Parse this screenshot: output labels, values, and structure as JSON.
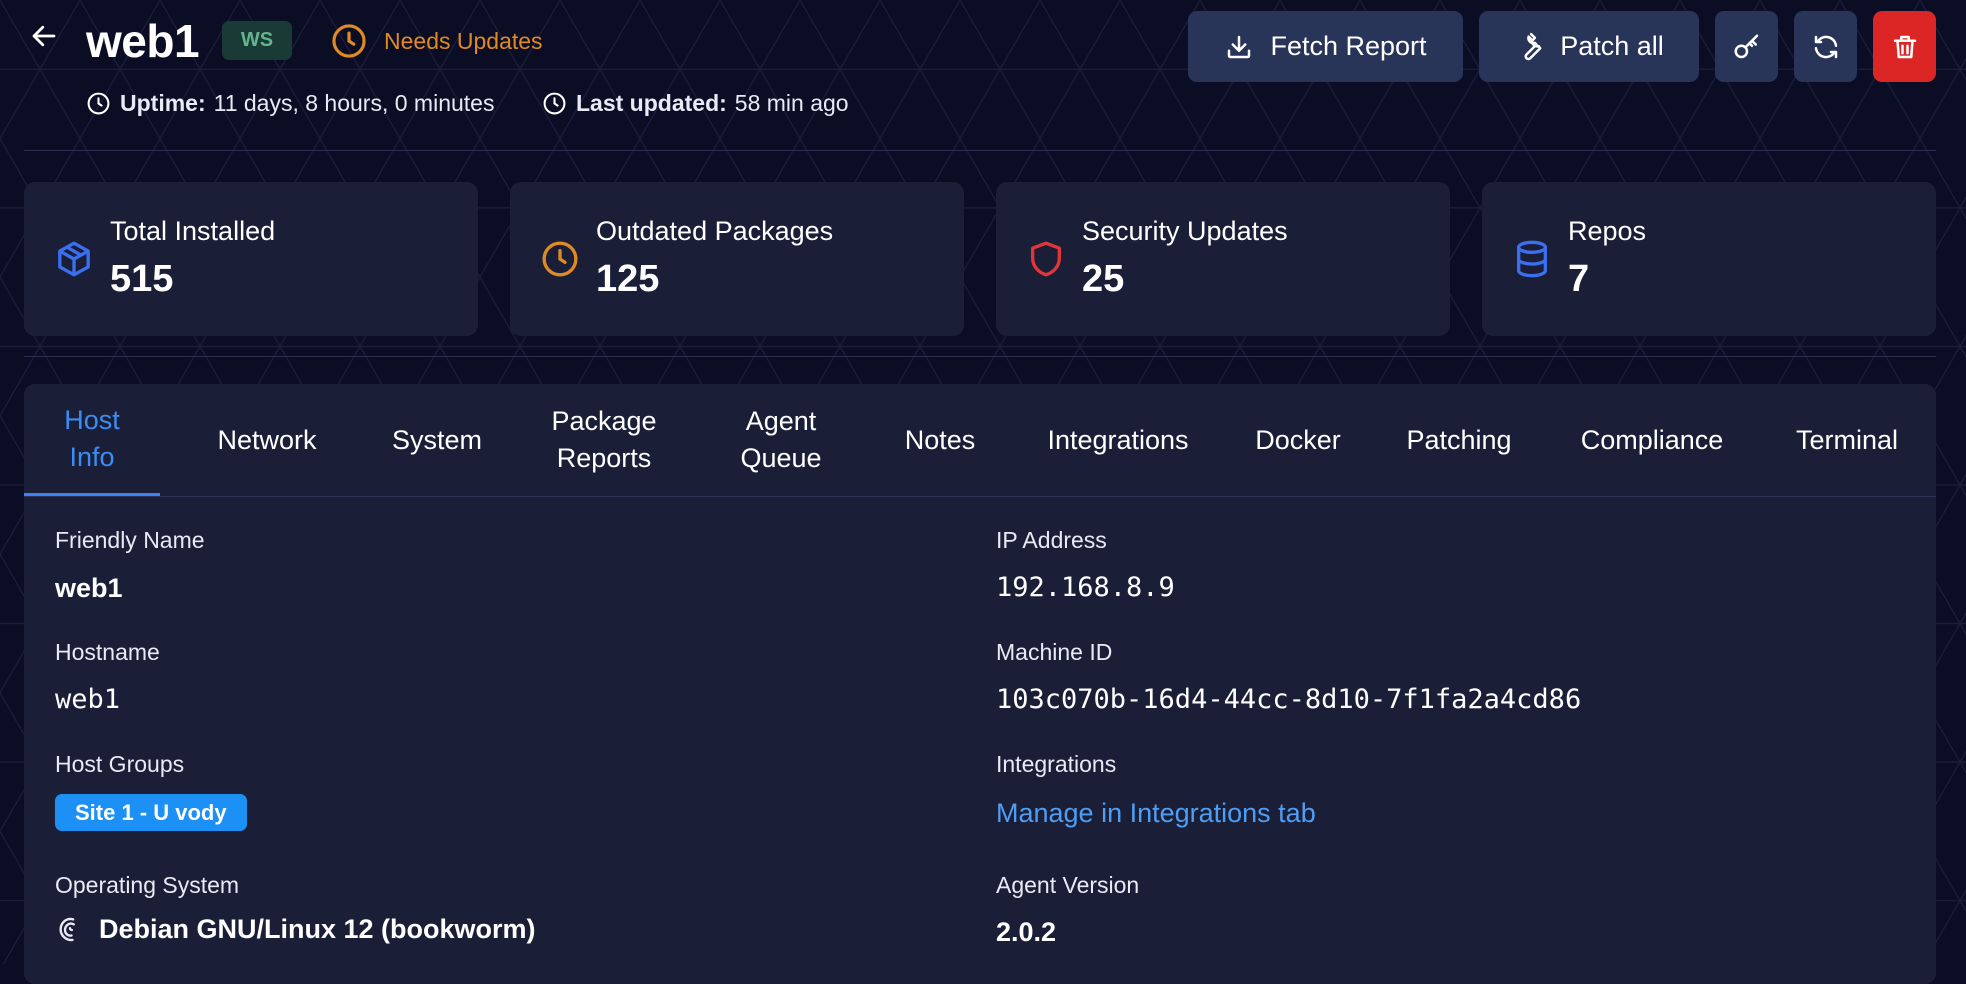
{
  "header": {
    "back_label": "Back",
    "host_name": "web1",
    "os_badge": "WS",
    "status": "Needs Updates",
    "status_color": "#e08a24",
    "uptime_label": "Uptime:",
    "uptime_value": "11 days, 8 hours, 0 minutes",
    "last_updated_label": "Last updated:",
    "last_updated_value": "58 min ago",
    "buttons": {
      "fetch_report": "Fetch Report",
      "patch_all": "Patch all",
      "credentials_icon": "key-icon",
      "refresh_icon": "refresh-icon",
      "delete_icon": "trash-icon"
    }
  },
  "stats": [
    {
      "label": "Total Installed",
      "value": "515",
      "icon": "package-icon",
      "color": "#3b6ff0"
    },
    {
      "label": "Outdated Packages",
      "value": "125",
      "icon": "clock-icon",
      "color": "#e08a24"
    },
    {
      "label": "Security Updates",
      "value": "25",
      "icon": "shield-icon",
      "color": "#e0363a"
    },
    {
      "label": "Repos",
      "value": "7",
      "icon": "database-icon",
      "color": "#3b6ff0"
    }
  ],
  "tabs": [
    {
      "label": "Host\nInfo",
      "active": true
    },
    {
      "label": "Network"
    },
    {
      "label": "System"
    },
    {
      "label": "Package\nReports"
    },
    {
      "label": "Agent\nQueue"
    },
    {
      "label": "Notes"
    },
    {
      "label": "Integrations"
    },
    {
      "label": "Docker"
    },
    {
      "label": "Patching"
    },
    {
      "label": "Compliance"
    },
    {
      "label": "Terminal"
    }
  ],
  "host_info": {
    "friendly_name_label": "Friendly Name",
    "friendly_name": "web1",
    "hostname_label": "Hostname",
    "hostname": "web1",
    "host_groups_label": "Host Groups",
    "host_group": "Site 1 - U vody",
    "os_label": "Operating System",
    "os_value": "Debian GNU/Linux 12 (bookworm)",
    "os_icon": "debian-icon",
    "ip_label": "IP Address",
    "ip": "192.168.8.9",
    "machine_id_label": "Machine ID",
    "machine_id": "103c070b-16d4-44cc-8d10-7f1fa2a4cd86",
    "integrations_label": "Integrations",
    "integrations_link": "Manage in Integrations tab",
    "agent_version_label": "Agent Version",
    "agent_version": "2.0.2"
  }
}
